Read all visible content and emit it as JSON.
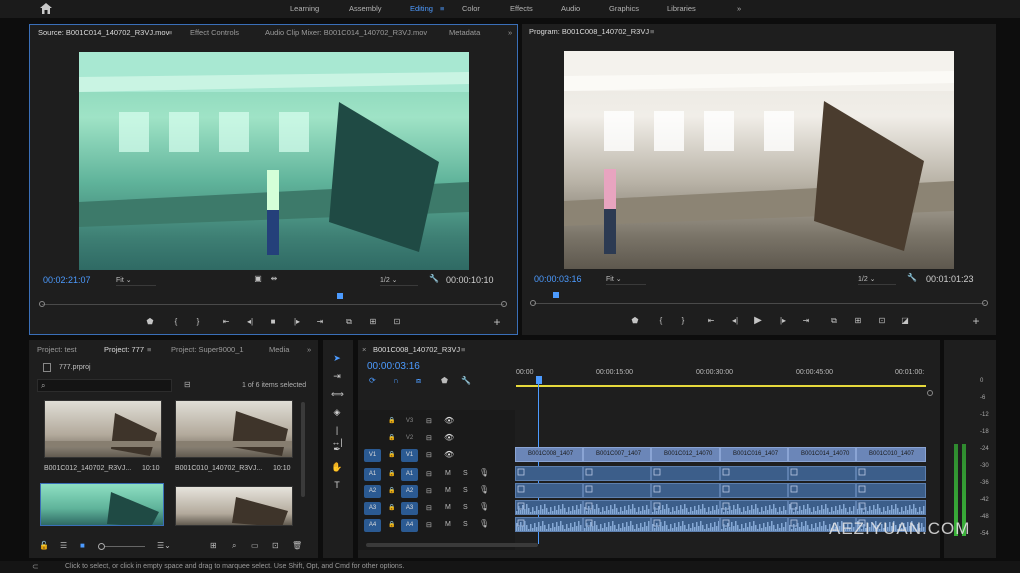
{
  "workspaces": [
    "Learning",
    "Assembly",
    "Editing",
    "Color",
    "Effects",
    "Audio",
    "Graphics",
    "Libraries"
  ],
  "active_workspace": "Editing",
  "source": {
    "tabs": [
      "Source: B001C014_140702_R3VJ.mov",
      "Effect Controls",
      "Audio Clip Mixer: B001C014_140702_R3VJ.mov",
      "Metadata"
    ],
    "timecode": "00:02:21:07",
    "fit": "Fit",
    "resolution": "1/2",
    "duration": "00:00:10:10"
  },
  "program": {
    "tab": "Program: B001C008_140702_R3VJ",
    "timecode": "00:00:03:16",
    "fit": "Fit",
    "resolution": "1/2",
    "duration": "00:01:01:23"
  },
  "project": {
    "tabs": [
      "Project: test",
      "Project: 777",
      "Project: Super9000_1",
      "Media"
    ],
    "file": "777.prproj",
    "count": "1 of 6 items selected",
    "search_placeholder": "",
    "items": [
      {
        "name": "B001C012_140702_R3VJ...",
        "duration": "10:10"
      },
      {
        "name": "B001C010_140702_R3VJ...",
        "duration": "10:10"
      }
    ]
  },
  "timeline": {
    "tab": "B001C008_140702_R3VJ",
    "timecode": "00:00:03:16",
    "ruler": [
      "00:00",
      "00:00:15:00",
      "00:00:30:00",
      "00:00:45:00",
      "00:01:00:"
    ],
    "video_tracks": [
      "V3",
      "V2",
      "V1"
    ],
    "audio_tracks": [
      "A1",
      "A2",
      "A3",
      "A4"
    ],
    "clips": [
      "B001C008_1407",
      "B001C007_1407",
      "B001C012_14070",
      "B001C016_1407",
      "B001C014_14070",
      "B001C010_1407"
    ],
    "mute": "M",
    "solo": "S"
  },
  "meter_scale": [
    "0",
    "-6",
    "-12",
    "-18",
    "-24",
    "-30",
    "-36",
    "-42",
    "-48",
    "-54"
  ],
  "status_text": "Click to select, or click in empty space and drag to marquee select. Use Shift, Opt, and Cmd for other options.",
  "watermark": "AEZIYUAN.COM",
  "colors": {
    "accent": "#4c9bff",
    "video_clip": "#6b86b8",
    "audio_clip": "#3c5e8a"
  }
}
